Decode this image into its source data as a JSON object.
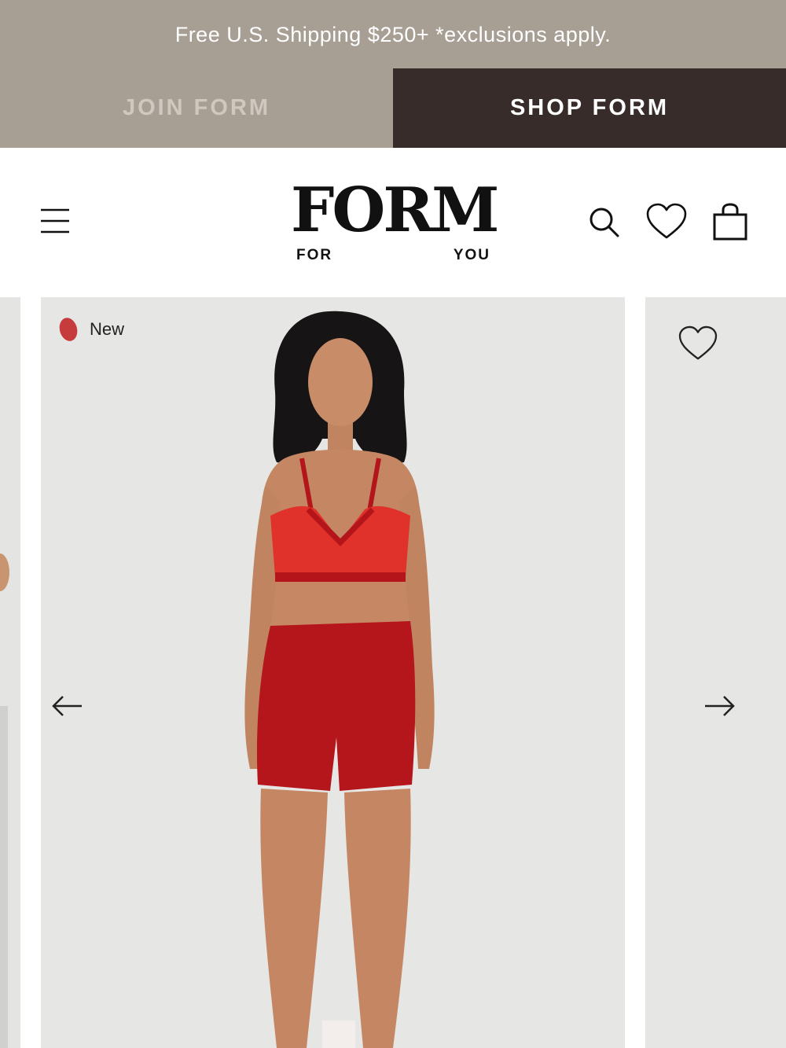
{
  "announcement": {
    "text": "Free U.S. Shipping $250+ *exclusions apply."
  },
  "tabs": [
    {
      "label": "JOIN FORM",
      "active": false
    },
    {
      "label": "SHOP FORM",
      "active": true
    }
  ],
  "header": {
    "logo": {
      "word": "FORM",
      "sub_left": "FOR",
      "sub_right": "YOU"
    },
    "icons": [
      "menu-icon",
      "search-icon",
      "heart-icon",
      "shopping-bag-icon"
    ]
  },
  "product": {
    "badge": "New",
    "badge_color": "#c63b3b",
    "image": "model-red-sports-bra-and-shorts",
    "apparel_colors": {
      "bra": "#e0312a",
      "shorts": "#b5161c"
    }
  },
  "colors": {
    "announcement_bg": "#a89f94",
    "active_tab_bg": "#382c2a",
    "inactive_tab_text": "#cfc8bf",
    "image_bg": "#e6e6e4"
  }
}
